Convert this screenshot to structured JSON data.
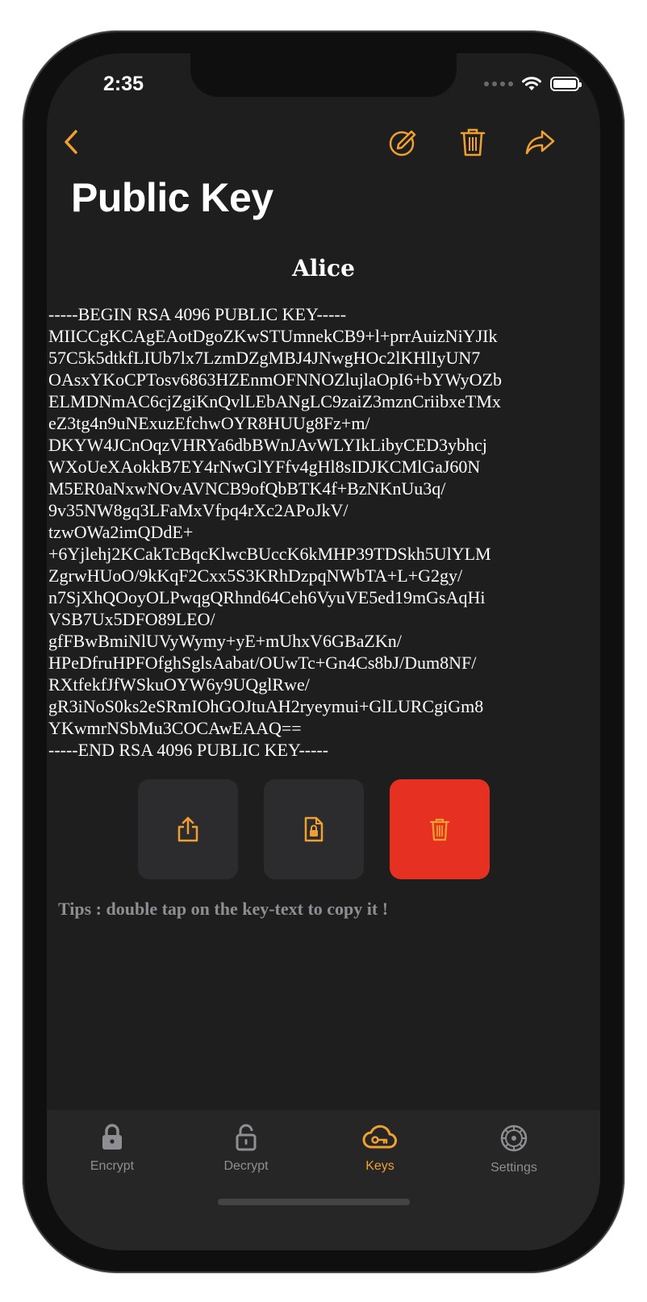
{
  "status": {
    "time": "2:35"
  },
  "nav": {
    "title": "Public Key"
  },
  "key": {
    "name": "Alice",
    "text": "-----BEGIN RSA 4096 PUBLIC KEY-----\nMIICCgKCAgEAotDgoZKwSTUmnekCB9+l+prrAuizNiYJIk\n57C5k5dtkfLIUb7lx7LzmDZgMBJ4JNwgHOc2lKHlIyUN7\nOAsxYKoCPTosv6863HZEnmOFNNOZlujlaOpI6+bYWyOZb\nELMDNmAC6cjZgiKnQvlLEbANgLC9zaiZ3mznCriibxeTMx\neZ3tg4n9uNExuzEfchwOYR8HUUg8Fz+m/\nDKYW4JCnOqzVHRYa6dbBWnJAvWLYIkLibyCED3ybhcj\nWXoUeXAokkB7EY4rNwGlYFfv4gHl8sIDJKCMlGaJ60N\nM5ER0aNxwNOvAVNCB9ofQbBTK4f+BzNKnUu3q/\n9v35NW8gq3LFaMxVfpq4rXc2APoJkV/\ntzwOWa2imQDdE+\n+6Yjlehj2KCakTcBqcKlwcBUccK6kMHP39TDSkh5UlYLM\nZgrwHUoO/9kKqF2Cxx5S3KRhDzpqNWbTA+L+G2gy/\nn7SjXhQOoyOLPwqgQRhnd64Ceh6VyuVE5ed19mGsAqHi\nVSB7Ux5DFO89LEO/\ngfFBwBmiNlUVyWymy+yE+mUhxV6GBaZKn/\nHPeDfruHPFOfghSglsAabat/OUwTc+Gn4Cs8bJ/Dum8NF/\nRXtfekfJfWSkuOYW6y9UQglRwe/\ngR3iNoS0ks2eSRmIOhGOJtuAH2ryeymui+GlLURCgiGm8\nYKwmrNSbMu3COCAwEAAQ==\n-----END RSA 4096 PUBLIC KEY-----"
  },
  "tips": "Tips : double tap on the key-text to copy it !",
  "tabs": [
    {
      "label": "Encrypt",
      "icon": "lock-icon",
      "active": false
    },
    {
      "label": "Decrypt",
      "icon": "unlock-icon",
      "active": false
    },
    {
      "label": "Keys",
      "icon": "cloud-key-icon",
      "active": true
    },
    {
      "label": "Settings",
      "icon": "gear-icon",
      "active": false
    }
  ],
  "colors": {
    "accent": "#f0a030",
    "danger": "#e63022",
    "background": "#1e1e1e",
    "tab_inactive": "#8e8e93"
  }
}
